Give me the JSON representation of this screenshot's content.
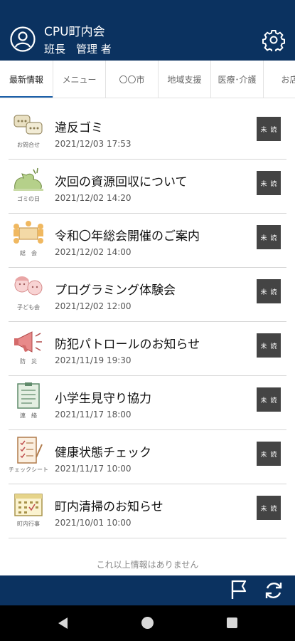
{
  "header": {
    "org_name": "CPU町内会",
    "user_role": "班長　管理 者"
  },
  "tabs": [
    {
      "label": "最新情報",
      "active": true
    },
    {
      "label": "メニュー"
    },
    {
      "label": "〇〇市"
    },
    {
      "label": "地域支援"
    },
    {
      "label": "医療･介護"
    },
    {
      "label": "お店"
    }
  ],
  "items": [
    {
      "icon": "speech-bubbles-icon",
      "category": "お問合せ",
      "title": "違反ゴミ",
      "date": "2021/12/03 17:53",
      "badge": [
        "未",
        "読"
      ]
    },
    {
      "icon": "garbage-bag-icon",
      "category": "ゴミの日",
      "title": "次回の資源回収について",
      "date": "2021/12/02 14:20",
      "badge": [
        "未",
        "読"
      ]
    },
    {
      "icon": "meeting-icon",
      "category": "総　会",
      "title": "令和〇年総会開催のご案内",
      "date": "2021/12/02 14:00",
      "badge": [
        "未",
        "読"
      ]
    },
    {
      "icon": "children-icon",
      "category": "子ども会",
      "title": "プログラミング体験会",
      "date": "2021/12/02 12:00",
      "badge": [
        "未",
        "読"
      ]
    },
    {
      "icon": "megaphone-icon",
      "category": "防　災",
      "title": "防犯パトロールのお知らせ",
      "date": "2021/11/19 19:30",
      "badge": [
        "未",
        "読"
      ]
    },
    {
      "icon": "notice-board-icon",
      "category": "連　絡",
      "title": "小学生見守り協力",
      "date": "2021/11/17 18:00",
      "badge": [
        "未",
        "読"
      ]
    },
    {
      "icon": "checklist-icon",
      "category": "チェックシート",
      "title": "健康状態チェック",
      "date": "2021/11/17 10:00",
      "badge": [
        "未",
        "読"
      ]
    },
    {
      "icon": "calendar-icon",
      "category": "町内行事",
      "title": "町内清掃のお知らせ",
      "date": "2021/10/01 10:00",
      "badge": [
        "未",
        "読"
      ]
    }
  ],
  "end_note": "これ以上情報はありません",
  "colors": {
    "header_bg": "#0b3260",
    "tab_underline": "#1b5fa8",
    "badge_bg": "#444444"
  }
}
